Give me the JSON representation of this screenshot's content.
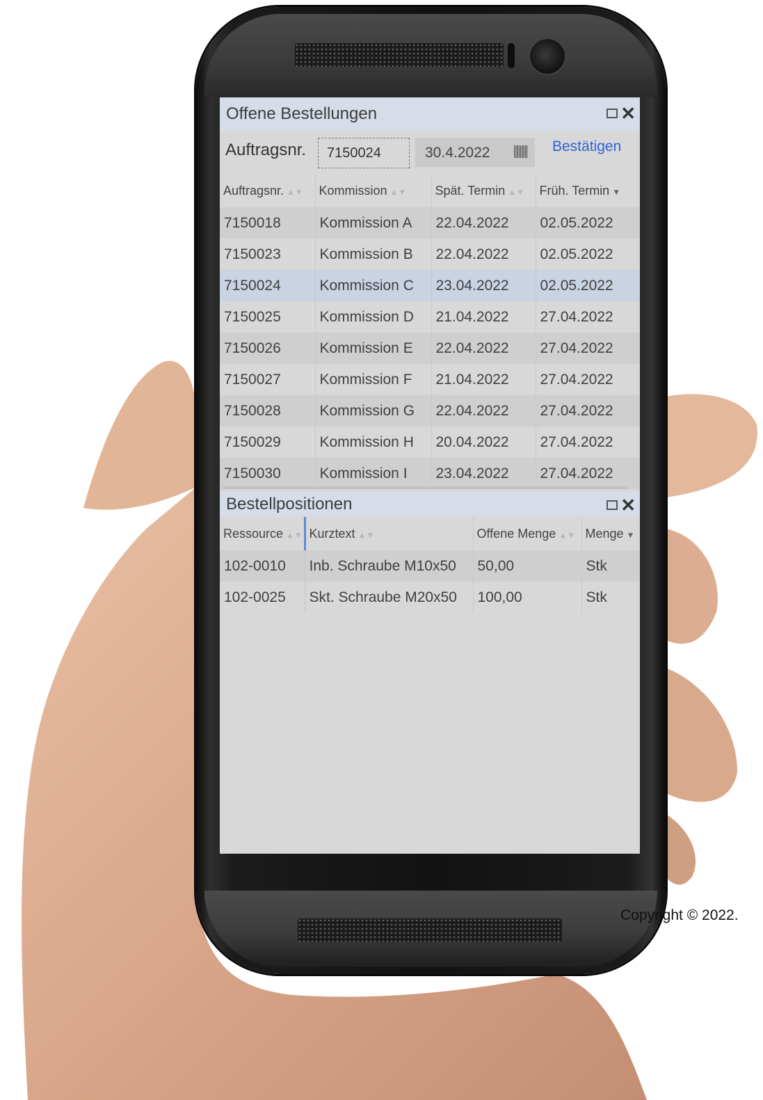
{
  "orders_panel": {
    "title": "Offene Bestellungen",
    "filter_label": "Auftragsnr.",
    "order_number_value": "7150024",
    "date_value": "30.4.2022",
    "confirm_label": "Bestätigen",
    "columns": [
      "Auftragsnr.",
      "Kommission",
      "Spät. Termin",
      "Früh. Termin"
    ],
    "rows": [
      {
        "nr": "7150018",
        "kommission": "Kommission A",
        "spaet": "22.04.2022",
        "frueh": "02.05.2022"
      },
      {
        "nr": "7150023",
        "kommission": "Kommission B",
        "spaet": "22.04.2022",
        "frueh": "02.05.2022"
      },
      {
        "nr": "7150024",
        "kommission": "Kommission C",
        "spaet": "23.04.2022",
        "frueh": "02.05.2022"
      },
      {
        "nr": "7150025",
        "kommission": "Kommission D",
        "spaet": "21.04.2022",
        "frueh": "27.04.2022"
      },
      {
        "nr": "7150026",
        "kommission": "Kommission E",
        "spaet": "22.04.2022",
        "frueh": "27.04.2022"
      },
      {
        "nr": "7150027",
        "kommission": "Kommission F",
        "spaet": "21.04.2022",
        "frueh": "27.04.2022"
      },
      {
        "nr": "7150028",
        "kommission": "Kommission G",
        "spaet": "22.04.2022",
        "frueh": "27.04.2022"
      },
      {
        "nr": "7150029",
        "kommission": "Kommission H",
        "spaet": "20.04.2022",
        "frueh": "27.04.2022"
      },
      {
        "nr": "7150030",
        "kommission": "Kommission I",
        "spaet": "23.04.2022",
        "frueh": "27.04.2022"
      }
    ],
    "selected_row": 2
  },
  "positions_panel": {
    "title": "Bestellpositionen",
    "columns": [
      "Ressource",
      "Kurztext",
      "Offene Menge",
      "Menge"
    ],
    "rows": [
      {
        "ressource": "102-0010",
        "kurztext": "Inb. Schraube M10x50",
        "menge_offen": "50,00",
        "einheit": "Stk"
      },
      {
        "ressource": "102-0025",
        "kurztext": "Skt. Schraube M20x50",
        "menge_offen": "100,00",
        "einheit": "Stk"
      }
    ]
  },
  "copyright": "Copyright © 2022.",
  "colors": {
    "panel_header": "#d6dde9",
    "selected_row": "#c9d3e1",
    "link": "#2c63d6",
    "screen_bg": "#d8d8d8"
  }
}
